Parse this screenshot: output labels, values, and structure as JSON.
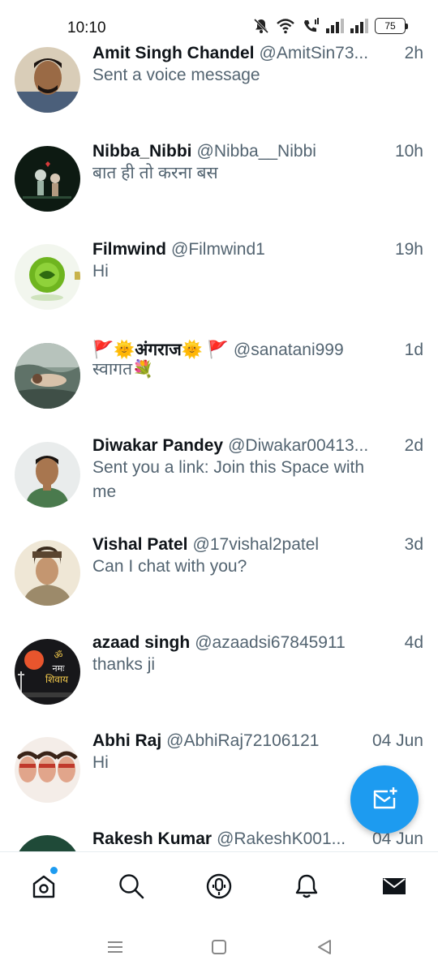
{
  "status_bar": {
    "time": "10:10",
    "battery": "75"
  },
  "conversations": [
    {
      "name": "Amit Singh Chandel",
      "handle": "@AmitSin73...",
      "time": "2h",
      "message": "Sent a voice message"
    },
    {
      "name": "Nibba_Nibbi",
      "handle": "@Nibba__Nibbi",
      "time": "10h",
      "message": "बात ही तो करना बस"
    },
    {
      "name": "Filmwind",
      "handle": "@Filmwind1",
      "time": "19h",
      "message": "Hi"
    },
    {
      "name": "🚩🌞अंगराज🌞 🚩",
      "handle": "@sanatani999",
      "time": "1d",
      "message": "स्वागत💐"
    },
    {
      "name": "Diwakar Pandey",
      "handle": "@Diwakar00413...",
      "time": "2d",
      "message": "Sent you a link: Join this Space with me"
    },
    {
      "name": "Vishal Patel",
      "handle": "@17vishal2patel",
      "time": "3d",
      "message": "Can I chat with you?"
    },
    {
      "name": "azaad singh",
      "handle": "@azaadsi67845911",
      "time": "4d",
      "message": "thanks ji"
    },
    {
      "name": "Abhi Raj",
      "handle": "@AbhiRaj72106121",
      "time": "04 Jun",
      "message": "Hi"
    },
    {
      "name": "Rakesh Kumar",
      "handle": "@RakeshK001...",
      "time": "04 Jun",
      "message": ""
    }
  ],
  "icons": {
    "fab": "new-message-icon",
    "nav": [
      "home-icon",
      "search-icon",
      "spaces-icon",
      "notifications-icon",
      "messages-icon"
    ],
    "system": [
      "recents-icon",
      "home-square-icon",
      "back-icon"
    ]
  },
  "colors": {
    "accent": "#1d9bf0",
    "text_primary": "#0f1419",
    "text_secondary": "#536471"
  }
}
